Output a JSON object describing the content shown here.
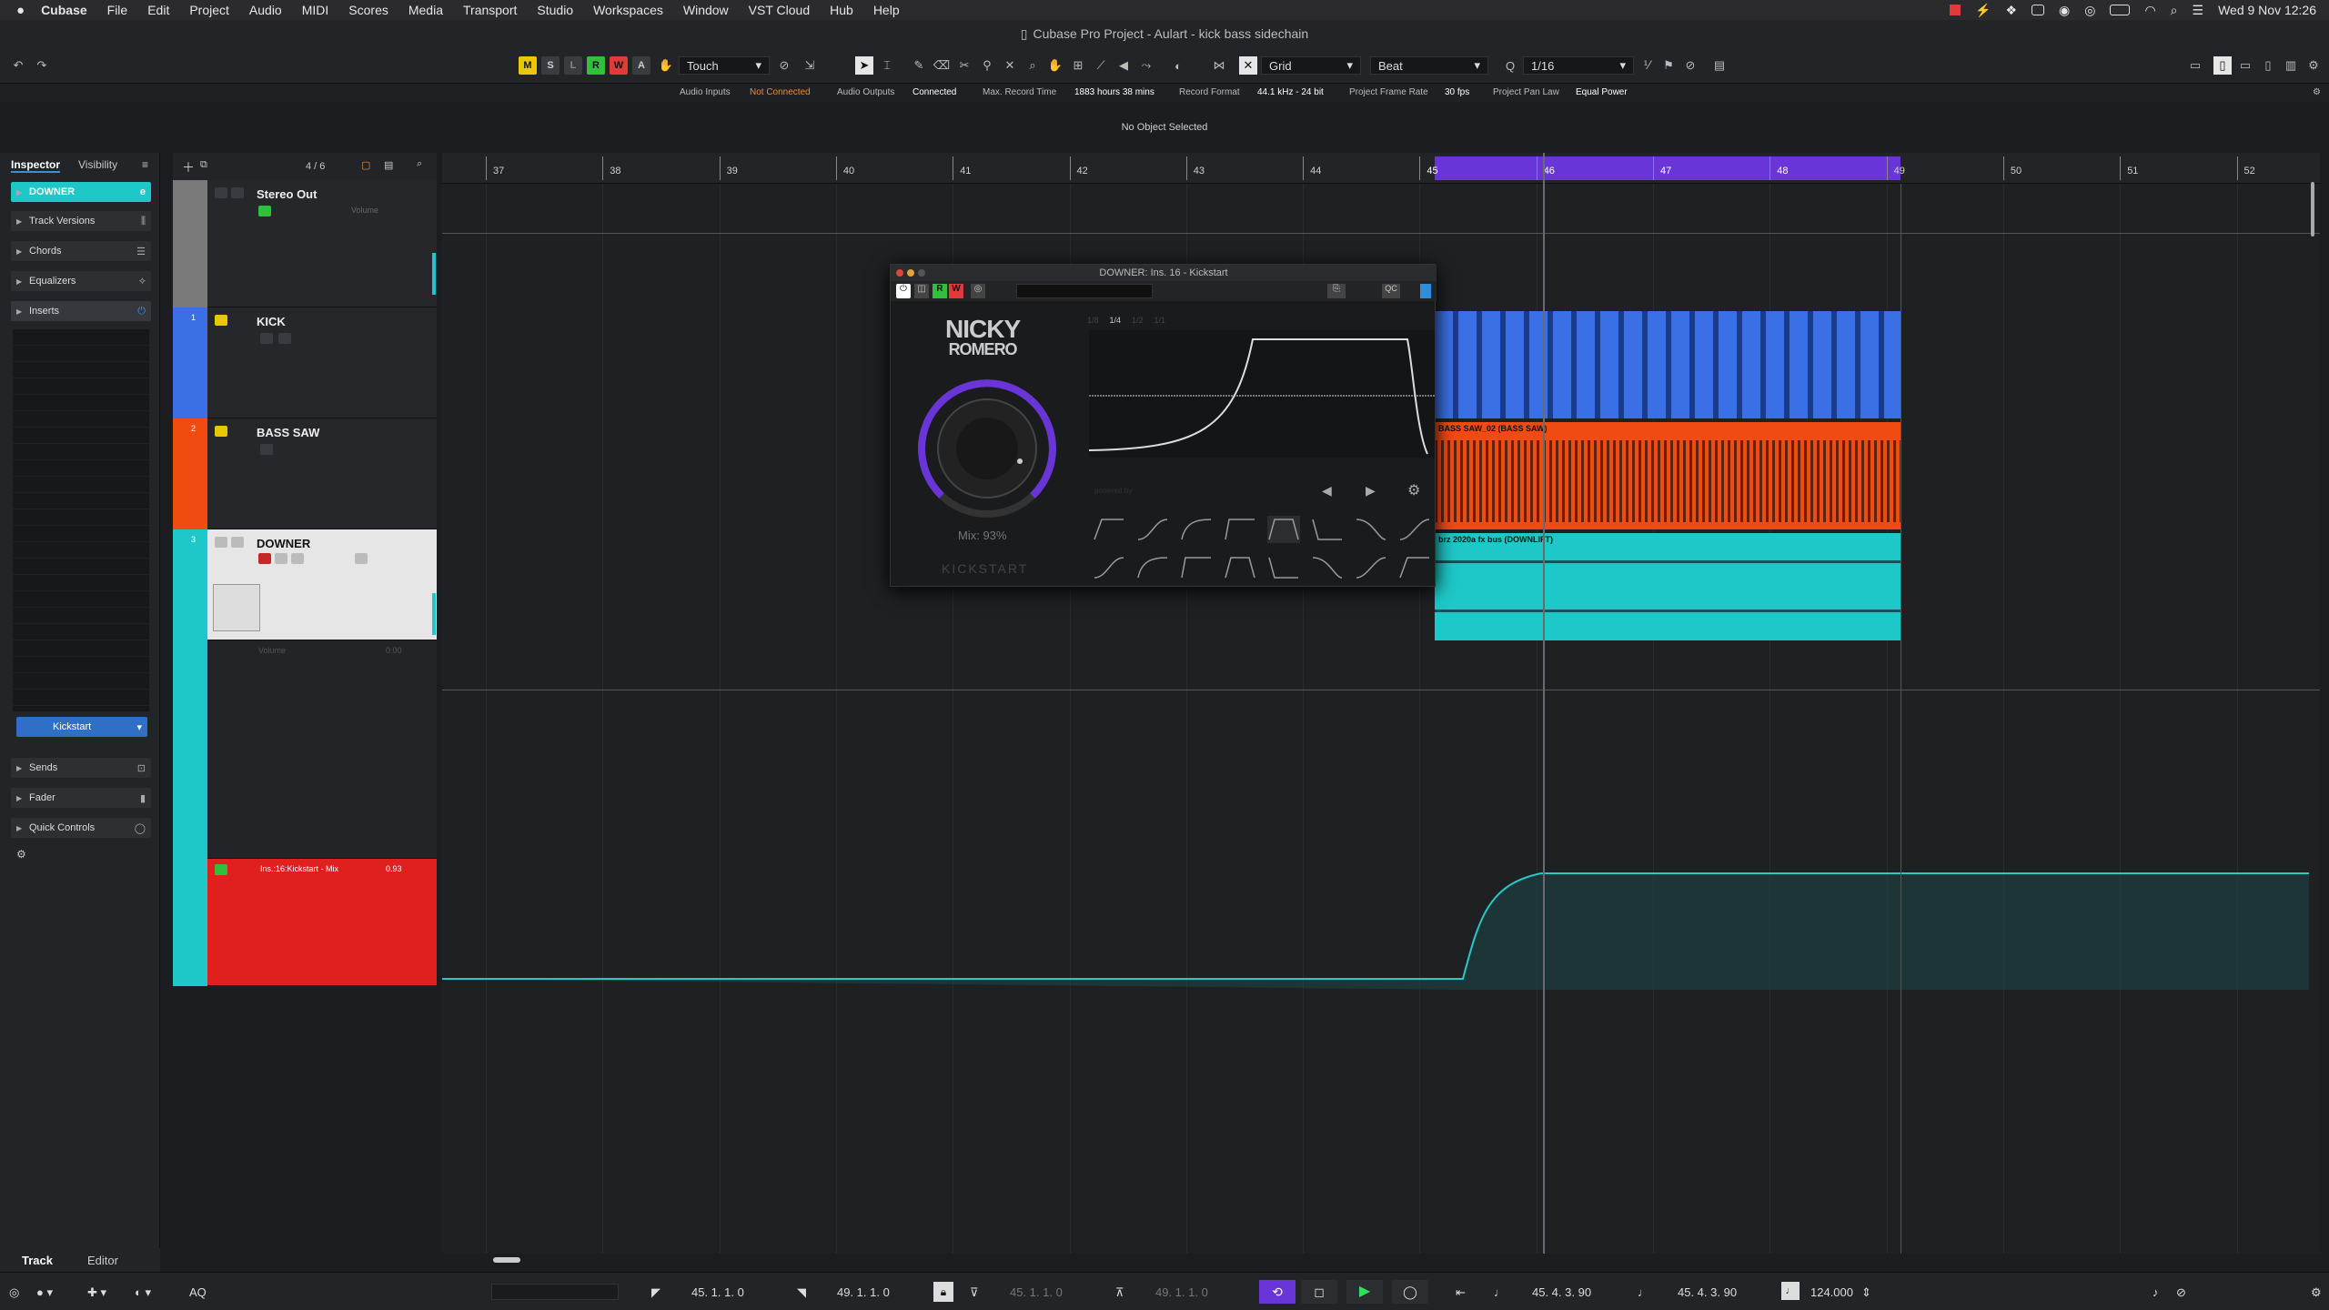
{
  "menubar": {
    "apple": "",
    "items": [
      "Cubase",
      "File",
      "Edit",
      "Project",
      "Audio",
      "MIDI",
      "Scores",
      "Media",
      "Transport",
      "Studio",
      "Workspaces",
      "Window",
      "VST Cloud",
      "Hub",
      "Help"
    ],
    "clock": "Wed 9 Nov  12:26"
  },
  "window": {
    "title": "Cubase Pro Project - Aulart - kick bass sidechain"
  },
  "toolbar": {
    "buttons": [
      {
        "label": "M",
        "color": "#e8c800"
      },
      {
        "label": "S",
        "color": "#3b3c40"
      },
      {
        "label": "L",
        "color": "#3b3c40"
      },
      {
        "label": "R",
        "color": "#32c03c"
      },
      {
        "label": "W",
        "color": "#e03a3a"
      },
      {
        "label": "A",
        "color": "#3b3c40"
      }
    ],
    "automation_mode": "Touch",
    "snap_type": "Grid",
    "grid_type": "Beat",
    "quantize": "1/16"
  },
  "status": {
    "audio_inputs_label": "Audio Inputs",
    "audio_inputs_value": "Not Connected",
    "audio_outputs_label": "Audio Outputs",
    "audio_outputs_value": "Connected",
    "max_record_label": "Max. Record Time",
    "max_record_value": "1883 hours 38 mins",
    "record_format_label": "Record Format",
    "record_format_value": "44.1 kHz - 24 bit",
    "frame_rate_label": "Project Frame Rate",
    "frame_rate_value": "30 fps",
    "pan_law_label": "Project Pan Law",
    "pan_law_value": "Equal Power"
  },
  "infoline": {
    "text": "No Object Selected"
  },
  "inspector": {
    "tabs": [
      "Inspector",
      "Visibility"
    ],
    "track_name": "DOWNER",
    "sections": [
      "Track Versions",
      "Chords",
      "Equalizers",
      "Inserts"
    ],
    "insert_slot": "Kickstart",
    "bottom_sections": [
      "Sends",
      "Fader",
      "Quick Controls"
    ]
  },
  "tracklist": {
    "counter": "4 / 6",
    "tracks": [
      {
        "name": "Stereo Out",
        "color": "#7a7a7a",
        "param": "Volume"
      },
      {
        "name": "KICK",
        "color": "#3a6fe6",
        "num": "1"
      },
      {
        "name": "BASS SAW",
        "color": "#f04c12",
        "num": "2"
      },
      {
        "name": "DOWNER",
        "color": "#1ec8c8",
        "num": "3"
      }
    ],
    "downer_volume_label": "Volume",
    "downer_volume_value": "0.00",
    "automation_label": "Ins.:16:Kickstart - Mix",
    "automation_value": "0.93"
  },
  "ruler": {
    "bars": [
      "37",
      "38",
      "39",
      "40",
      "41",
      "42",
      "43",
      "44",
      "45",
      "46",
      "47",
      "48",
      "49",
      "50",
      "51",
      "52"
    ]
  },
  "events": {
    "bass_label": "BASS SAW_02 (BASS SAW)",
    "downer_label": "brz 2020a fx bus (DOWNLIFT)"
  },
  "plugin": {
    "title": "DOWNER: Ins. 16 - Kickstart",
    "brand_line1": "NICKY",
    "brand_line2": "ROMERO",
    "mix": "Mix: 93%",
    "product": "KICKSTART",
    "rates": [
      "1/8",
      "1/4",
      "1/2",
      "1/1"
    ],
    "powered_by": "powered by"
  },
  "bottomtabs": [
    "Track",
    "Editor"
  ],
  "transport": {
    "left_locator": "45. 1. 1.   0",
    "right_locator": "49. 1. 1.   0",
    "punch_in": "45. 1. 1.   0",
    "punch_out": "49. 1. 1.   0",
    "primary_time": "45. 4. 3.  90",
    "secondary_time": "45. 4. 3.  90",
    "tempo": "124.000",
    "aq": "AQ"
  }
}
